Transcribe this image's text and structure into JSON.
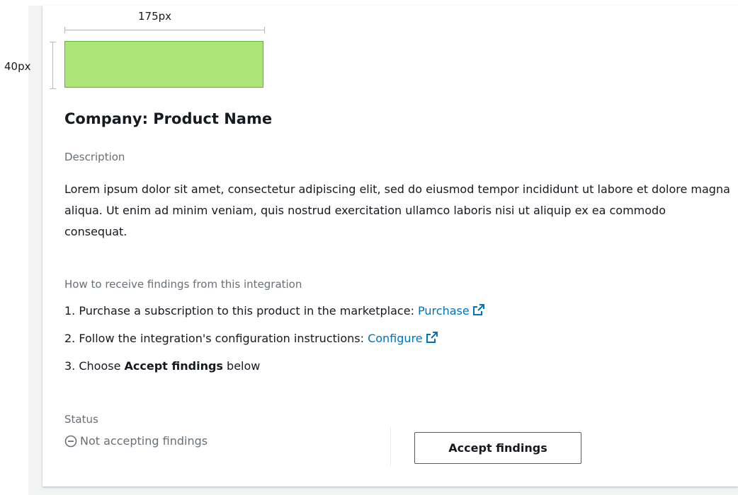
{
  "annotations": {
    "width_label": "175px",
    "height_label": "40px"
  },
  "product": {
    "title": "Company: Product Name"
  },
  "description": {
    "label": "Description",
    "text": "Lorem ipsum dolor sit amet, consectetur adipiscing elit, sed do eiusmod tempor incididunt ut labore et dolore magna aliqua. Ut enim ad minim veniam, quis nostrud exercitation ullamco laboris nisi ut aliquip ex ea commodo consequat."
  },
  "how_to": {
    "label": "How to receive findings from this integration",
    "step1_text": "1. Purchase a subscription to this product in the marketplace: ",
    "step1_link": "Purchase",
    "step2_text": "2. Follow the integration's configuration instructions: ",
    "step2_link": "Configure",
    "step3_prefix": "3. Choose ",
    "step3_bold": "Accept findings",
    "step3_suffix": " below"
  },
  "status": {
    "label": "Status",
    "value": "Not accepting findings"
  },
  "actions": {
    "accept_label": "Accept findings"
  },
  "colors": {
    "logo_fill": "#aee578",
    "logo_border": "#5dba2e",
    "link": "#0073bb",
    "muted_text": "#687078"
  },
  "icons": {
    "external_link": "external-link-icon",
    "status": "minus-circle-icon"
  }
}
